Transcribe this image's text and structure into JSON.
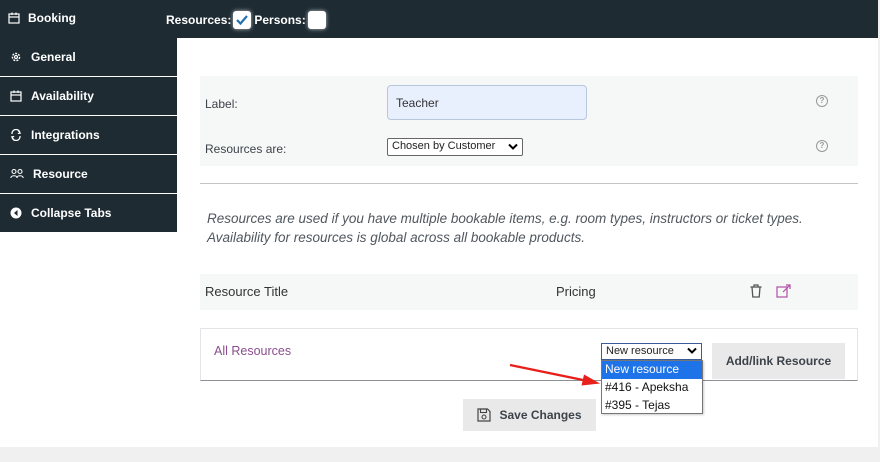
{
  "header": {
    "title": "Booking",
    "resources_label": "Resources:",
    "persons_label": "Persons:",
    "resources_checked": true,
    "persons_checked": false
  },
  "sidebar": {
    "items": [
      {
        "label": "General",
        "icon": "gear-icon"
      },
      {
        "label": "Availability",
        "icon": "calendar-icon"
      },
      {
        "label": "Integrations",
        "icon": "sync-icon"
      },
      {
        "label": "Resource",
        "icon": "users-icon",
        "active": true
      },
      {
        "label": "Collapse Tabs",
        "icon": "collapse-left-icon"
      }
    ]
  },
  "form": {
    "label_field": {
      "label": "Label:",
      "value": "Teacher"
    },
    "resources_are": {
      "label": "Resources are:",
      "value": "Chosen by Customer"
    },
    "help_glyph": "?"
  },
  "description": "Resources are used if you have multiple bookable items, e.g. room types, instructors or ticket types. Availability for resources is global across all bookable products.",
  "table": {
    "col_title": "Resource Title",
    "col_pricing": "Pricing"
  },
  "resources": {
    "all_label": "All Resources",
    "select_value": "New resource",
    "options": [
      "New resource",
      "#416 - Apeksha",
      "#395 - Tejas"
    ],
    "add_button": "Add/link Resource"
  },
  "save_button": "Save Changes",
  "colors": {
    "dark_nav": "#1e2b33",
    "link_purple": "#8a4d8e",
    "selected_blue": "#1e73e8",
    "annotation_red": "#e8201c"
  }
}
